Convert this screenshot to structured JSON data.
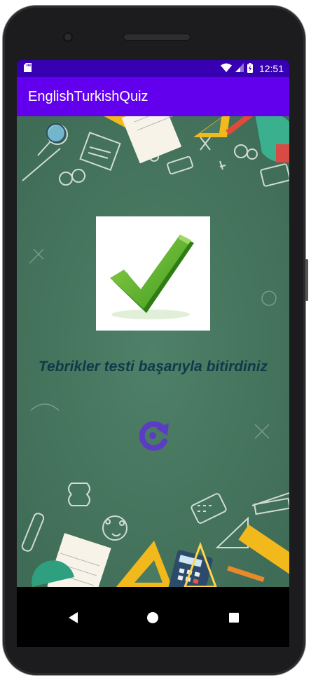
{
  "status_bar": {
    "time": "12:51",
    "icons": [
      "sd-card-icon",
      "wifi-icon",
      "signal-icon",
      "battery-charging-icon"
    ]
  },
  "app_bar": {
    "title": "EnglishTurkishQuiz"
  },
  "main": {
    "result_image_icon": "checkmark-icon",
    "message": "Tebrikler testi başarıyla bitirdiniz",
    "restart_icon": "restart-icon"
  },
  "nav_bar": {
    "buttons": [
      "back-icon",
      "home-icon",
      "recents-icon"
    ]
  },
  "colors": {
    "status_bar": "#3700b3",
    "app_bar": "#6200ee",
    "board": "#4a7a62",
    "message": "#0f3a4a",
    "restart": "#5b3cc4"
  }
}
